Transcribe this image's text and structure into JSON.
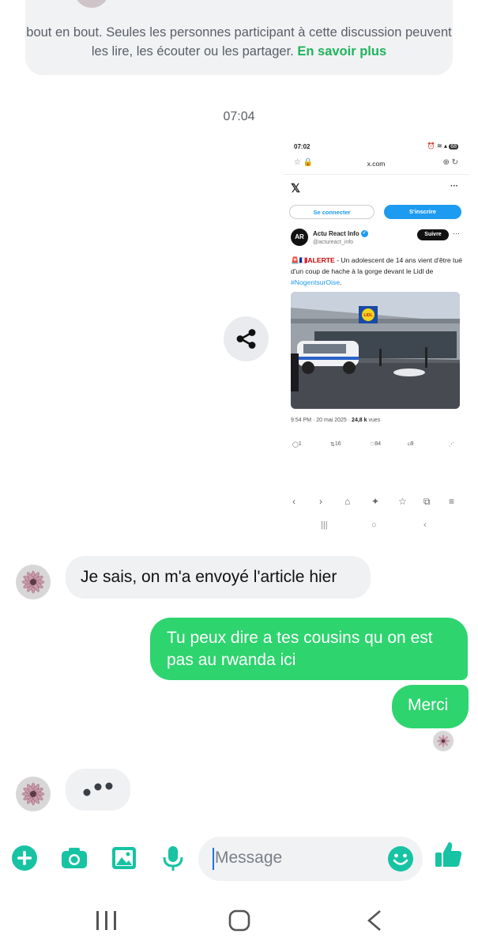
{
  "encryption_notice": {
    "text": "bout en bout. Seules les personnes participant à cette discussion peuvent les lire, les écouter ou les partager.",
    "link": "En savoir plus"
  },
  "timestamp": "07:04",
  "shared_screenshot": {
    "status_time": "07:02",
    "battery": "68",
    "url": "x.com",
    "login_button": "Se connecter",
    "signup_button": "S'inscrire",
    "account_name": "Actu React Info",
    "account_handle": "@actureact_info",
    "account_logo": "AR",
    "follow_button": "Suivre",
    "tweet_prefix": "🚨🇫🇷",
    "tweet_alert": "ALERTE",
    "tweet_body": " - Un adolescent de 14 ans vient d'être tué d'un coup de hache à la gorge devant le Lidl de ",
    "tweet_hashtag": "#NogentsurOise",
    "tweet_end": ".",
    "store_sign": "LIDL",
    "posted": "9:54 PM · 20 mai 2025 · ",
    "views_count": "24,8 k",
    "views_label": " vues",
    "replies": "1",
    "retweets": "16",
    "likes": "84",
    "bookmarks": "9"
  },
  "messages": [
    {
      "direction": "incoming",
      "text": "Je sais, on m'a envoyé l'article hier"
    },
    {
      "direction": "outgoing",
      "text": "Tu peux dire a tes cousins qu on est pas au rwanda ici"
    },
    {
      "direction": "outgoing",
      "text": "Merci"
    }
  ],
  "composer": {
    "placeholder": "Message",
    "icons": [
      "plus-icon",
      "camera-icon",
      "gallery-icon",
      "microphone-icon",
      "emoji-icon",
      "thumbs-up-icon"
    ]
  },
  "colors": {
    "accent": "#2ed46e",
    "icon": "#17c3a3",
    "incoming_bubble": "#eff1f3"
  }
}
